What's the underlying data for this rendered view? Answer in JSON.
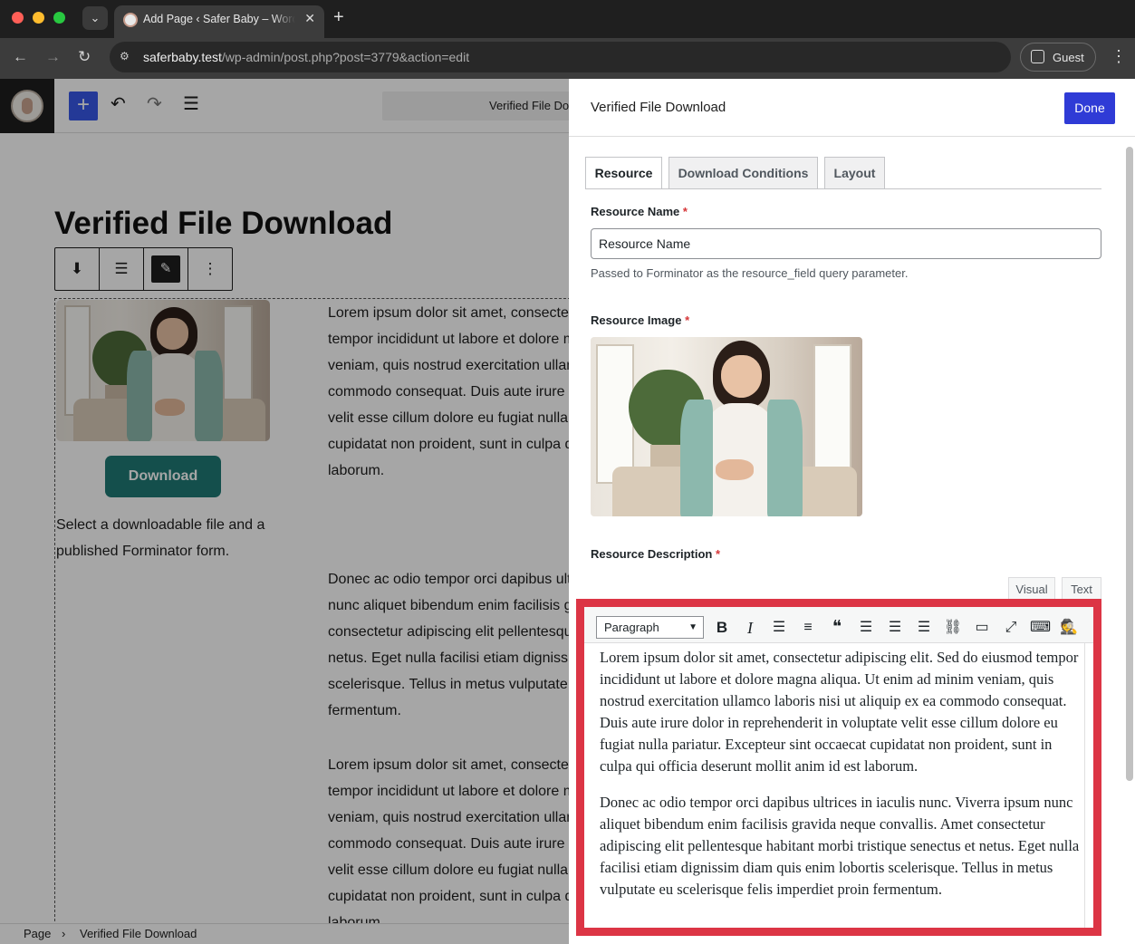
{
  "browser": {
    "tab_title": "Add Page ‹ Safer Baby – WordPress",
    "url_host": "saferbaby.test",
    "url_path": "/wp-admin/post.php?post=3779&action=edit",
    "profile_label": "Guest",
    "icons": [
      "close-icon",
      "plus-icon",
      "back-icon",
      "forward-icon",
      "reload-icon",
      "site-info-icon",
      "kebab-icon"
    ]
  },
  "editor": {
    "document_title": "Verified File Download",
    "post_title": "Verified File Download",
    "download_button": "Download",
    "left_note": "Select a downloadable file and a published Forminator form.",
    "paragraph1": "Lorem ipsum dolor sit amet, consectetur adipiscing elit. Sed do eiusmod tempor incididunt ut labore et dolore magna aliqua. Ut enim ad minim veniam, quis nostrud exercitation ullamco laboris nisi ut aliquip ex ea commodo consequat. Duis aute irure dolor in reprehenderit in voluptate velit esse cillum dolore eu fugiat nulla pariatur. Excepteur sint occaecat cupidatat non proident, sunt in culpa qui officia deserunt mollit anim id est laborum.",
    "paragraph2": "Donec ac odio tempor orci dapibus ultrices in iaculis nunc. Viverra ipsum nunc aliquet bibendum enim facilisis gravida neque convallis. Amet consectetur adipiscing elit pellentesque habitant morbi tristique senectus et netus. Eget nulla facilisi etiam dignissim diam quis enim lobortis scelerisque. Tellus in metus vulputate eu scelerisque felis imperdiet proin fermentum.",
    "paragraph3": "Lorem ipsum dolor sit amet, consectetur adipiscing elit. Sed do eiusmod tempor incididunt ut labore et dolore magna aliqua. Ut enim ad minim veniam, quis nostrud exercitation ullamco laboris nisi ut aliquip ex ea commodo consequat. Duis aute irure dolor in reprehenderit in voluptate velit esse cillum dolore eu fugiat nulla pariatur. Excepteur sint occaecat cupidatat non proident, sunt in culpa qui officia deserunt mollit anim id est laborum.",
    "left_lines_p1": [
      "Lorem ipsum dolor sit amet, consectetur",
      "tempor incididunt ut labore et dolore m",
      "veniam, quis nostrud exercitation ullam",
      "commodo consequat. Duis aute irure d",
      "velit esse cillum dolore eu fugiat nulla",
      "cupidatat non proident, sunt in culpa q",
      "laborum."
    ],
    "left_lines_p2": [
      "Donec ac odio tempor orci dapibus ultr",
      "nunc aliquet bibendum enim facilisis g",
      "consectetur adipiscing elit pellentesqu",
      "netus. Eget nulla facilisi etiam digniss",
      "scelerisque. Tellus in metus vulputate",
      "fermentum."
    ],
    "left_lines_p3": [
      "Lorem ipsum dolor sit amet, consectetur",
      "tempor incididunt ut labore et dolore m",
      "veniam, quis nostrud exercitation ullam",
      "commodo consequat. Duis aute irure d",
      "velit esse cillum dolore eu fugiat nulla",
      "cupidatat non proident, sunt in culpa q",
      "laborum."
    ],
    "breadcrumb": [
      "Page",
      "Verified File Download"
    ],
    "inserter_label": "+"
  },
  "panel": {
    "title": "Verified File Download",
    "done_label": "Done",
    "tabs": [
      "Resource",
      "Download Conditions",
      "Layout"
    ],
    "active_tab": "Resource",
    "resource_name_label": "Resource Name",
    "required_mark": "*",
    "resource_name_value": "Resource Name",
    "resource_name_help": "Passed to Forminator as the resource_field query parameter.",
    "resource_image_label": "Resource Image",
    "resource_description_label": "Resource Description",
    "mode_visual": "Visual",
    "mode_text": "Text",
    "format_select": "Paragraph",
    "toolbar_icons": [
      "bold-icon",
      "italic-icon",
      "bullet-list-icon",
      "numbered-list-icon",
      "blockquote-icon",
      "align-left-icon",
      "align-center-icon",
      "align-right-icon",
      "link-icon",
      "read-more-icon",
      "fullscreen-icon",
      "toolbar-toggle-icon",
      "spy-icon"
    ],
    "toolbar_glyphs": {
      "bold": "B",
      "italic": "I",
      "bullets": "☰",
      "numbers": "≡",
      "quote": "❝",
      "align_left": "☰",
      "align_center": "☰",
      "align_right": "☰",
      "link": "⛓",
      "more": "▭",
      "fullscreen": "⤢",
      "toggle": "⌨",
      "spy": "🕵"
    },
    "highlight_color": "#dc3545",
    "accent_color": "#2f3bd6"
  }
}
